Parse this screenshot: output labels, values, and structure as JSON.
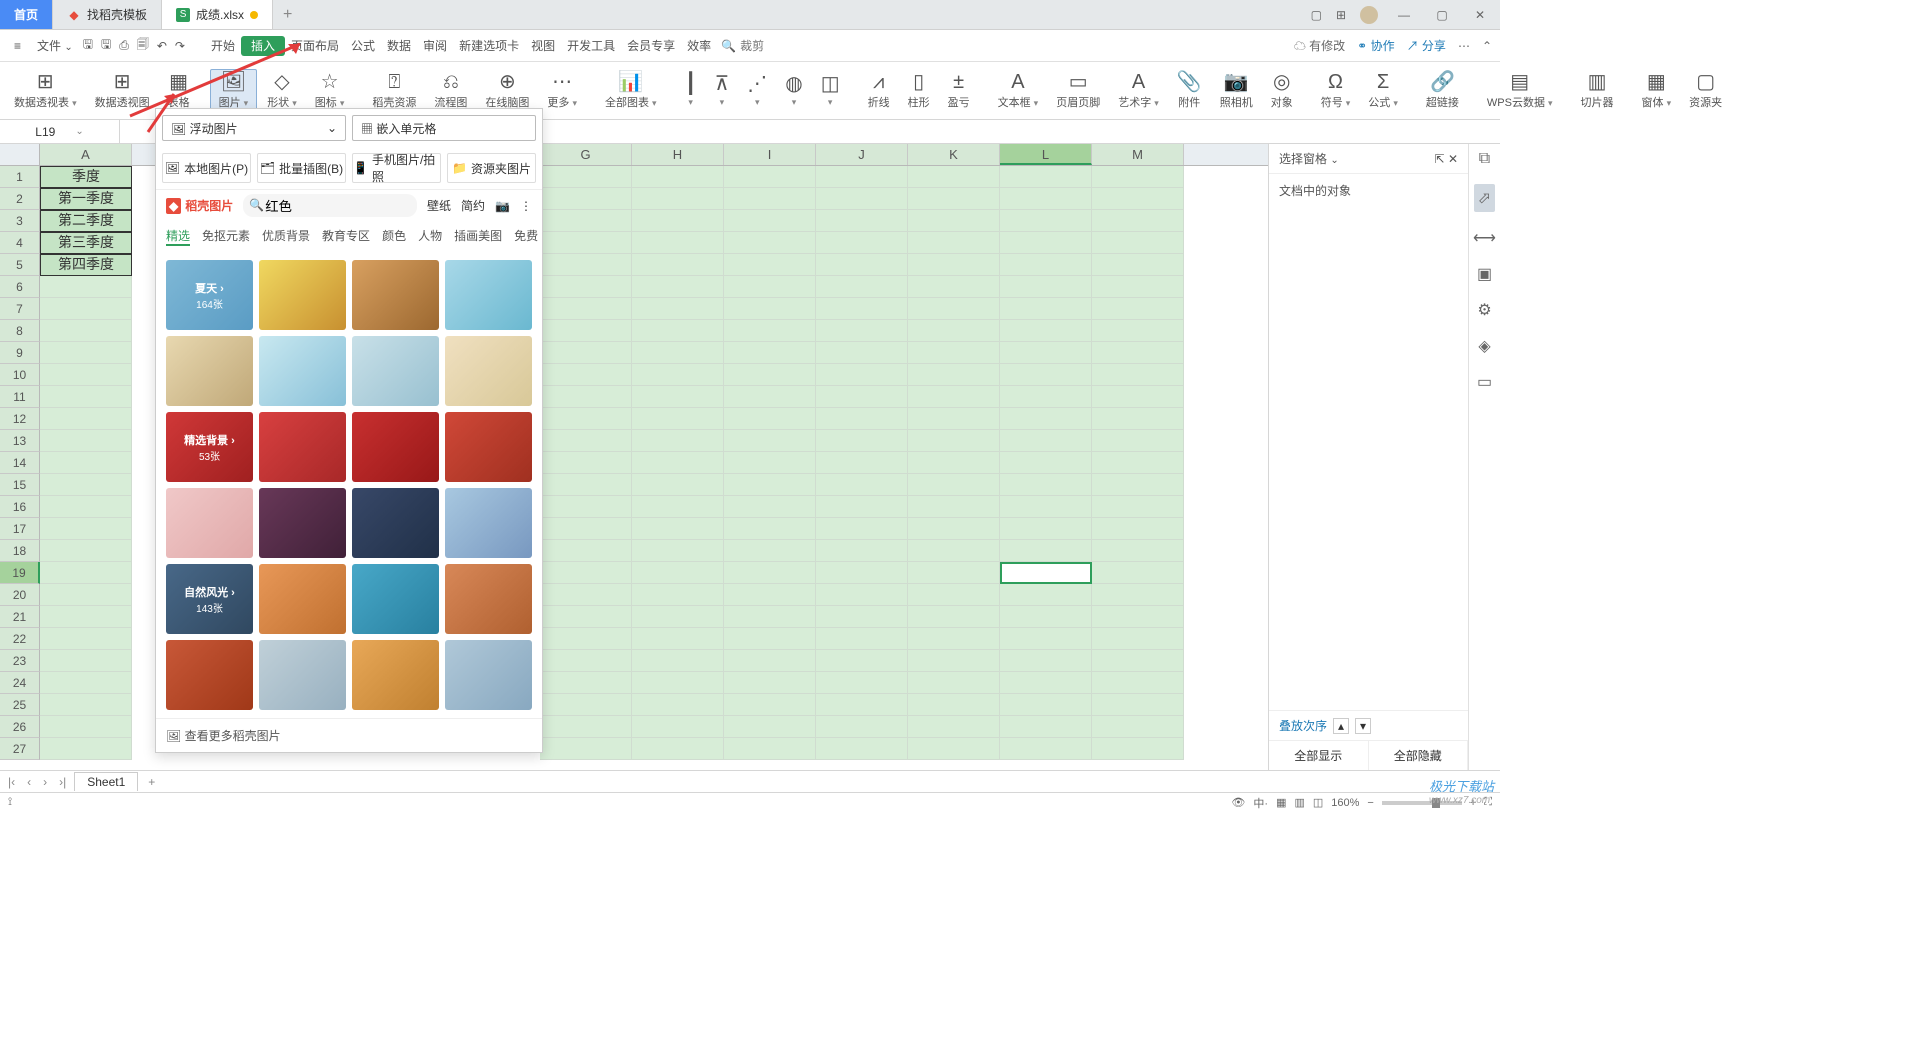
{
  "titlebar": {
    "home": "首页",
    "tab1": "找稻壳模板",
    "tab2": "成绩.xlsx",
    "add": "+"
  },
  "menu": {
    "file": "文件",
    "items": [
      "开始",
      "插入",
      "页面布局",
      "公式",
      "数据",
      "审阅",
      "新建选项卡",
      "视图",
      "开发工具",
      "会员专享",
      "效率"
    ],
    "search_placeholder": "裁剪",
    "right": {
      "change": "有修改",
      "collab": "协作",
      "share": "分享"
    }
  },
  "toolbar": [
    {
      "label": "数据透视表",
      "drop": true
    },
    {
      "label": "数据透视图"
    },
    {
      "label": "表格"
    },
    {
      "label": "图片",
      "drop": true,
      "hl": true
    },
    {
      "label": "形状",
      "drop": true
    },
    {
      "label": "图标",
      "drop": true
    },
    {
      "label": "稻壳资源"
    },
    {
      "label": "流程图"
    },
    {
      "label": "在线脑图"
    },
    {
      "label": "更多",
      "drop": true
    },
    {
      "label": "全部图表",
      "drop": true
    },
    {
      "label": "",
      "drop": true
    },
    {
      "label": "",
      "drop": true
    },
    {
      "label": "",
      "drop": true
    },
    {
      "label": "",
      "drop": true
    },
    {
      "label": "",
      "drop": true
    },
    {
      "label": "折线"
    },
    {
      "label": "柱形"
    },
    {
      "label": "盈亏"
    },
    {
      "label": "文本框",
      "drop": true
    },
    {
      "label": "页眉页脚"
    },
    {
      "label": "艺术字",
      "drop": true
    },
    {
      "label": "附件"
    },
    {
      "label": "照相机"
    },
    {
      "label": "对象"
    },
    {
      "label": "符号",
      "drop": true
    },
    {
      "label": "公式",
      "drop": true
    },
    {
      "label": "超链接"
    },
    {
      "label": "WPS云数据",
      "drop": true
    },
    {
      "label": "切片器"
    },
    {
      "label": "窗体",
      "drop": true
    },
    {
      "label": "资源夹"
    }
  ],
  "toolbar_icons": [
    "⊞",
    "⊞",
    "▦",
    "🖼",
    "◇",
    "☆",
    "⍰",
    "⎌",
    "⊕",
    "⋯",
    "📊",
    "┃",
    "⊼",
    "⋰",
    "◍",
    "◫",
    "⩘",
    "▯",
    "±",
    "A",
    "▭",
    "A",
    "📎",
    "📷",
    "◎",
    "Ω",
    "Σ",
    "🔗",
    "▤",
    "▥",
    "▦",
    "▢"
  ],
  "namebox": "L19",
  "columns": [
    "A",
    "G",
    "H",
    "I",
    "J",
    "K",
    "L",
    "M"
  ],
  "rowdata": {
    "1": "季度",
    "2": "第一季度",
    "3": "第二季度",
    "4": "第三季度",
    "5": "第四季度"
  },
  "imgpanel": {
    "combo": "浮动图片",
    "embed": "嵌入单元格",
    "btns": [
      "本地图片(P)",
      "批量插图(B)",
      "手机图片/拍照",
      "资源夹图片"
    ],
    "brand": "稻壳图片",
    "search": "红色",
    "links": [
      "壁纸",
      "简约"
    ],
    "cats": [
      "精选",
      "免抠元素",
      "优质背景",
      "教育专区",
      "颜色",
      "人物",
      "插画美图",
      "免费"
    ],
    "thumbs": [
      {
        "bg": "linear-gradient(135deg,#7fb8d6,#5a9cc4)",
        "title": "夏天 ›",
        "sub": "164张"
      },
      {
        "bg": "linear-gradient(135deg,#f0d860,#c89030)"
      },
      {
        "bg": "linear-gradient(135deg,#d8a060,#9c6830)"
      },
      {
        "bg": "linear-gradient(135deg,#a8d8e8,#6ab8d0)"
      },
      {
        "bg": "linear-gradient(135deg,#e8d8b0,#c0a878)"
      },
      {
        "bg": "linear-gradient(135deg,#c8e8f0,#88c0d8)"
      },
      {
        "bg": "linear-gradient(135deg,#c8e0e8,#98c0d0)"
      },
      {
        "bg": "linear-gradient(135deg,#f0e0c0,#d8c898)"
      },
      {
        "bg": "linear-gradient(135deg,#d03838,#a02020)",
        "title": "精选背景 ›",
        "sub": "53张"
      },
      {
        "bg": "linear-gradient(135deg,#d84040,#a82828)"
      },
      {
        "bg": "linear-gradient(135deg,#c83030,#981818)"
      },
      {
        "bg": "linear-gradient(135deg,#d04838,#a03020)"
      },
      {
        "bg": "linear-gradient(135deg,#f0c8c8,#e0a8a8)"
      },
      {
        "bg": "linear-gradient(135deg,#683858,#402038)"
      },
      {
        "bg": "linear-gradient(135deg,#384868,#203048)"
      },
      {
        "bg": "linear-gradient(135deg,#a8c8e0,#7898c0)"
      },
      {
        "bg": "linear-gradient(135deg,#486888,#304860)",
        "title": "自然风光 ›",
        "sub": "143张"
      },
      {
        "bg": "linear-gradient(135deg,#e89858,#c07030)"
      },
      {
        "bg": "linear-gradient(135deg,#48a8c8,#2880a0)"
      },
      {
        "bg": "linear-gradient(135deg,#d88858,#b06030)"
      },
      {
        "bg": "linear-gradient(135deg,#c85838,#a03818)"
      },
      {
        "bg": "linear-gradient(135deg,#c0d0d8,#98b0c0)"
      },
      {
        "bg": "linear-gradient(135deg,#e8a858,#c08030)"
      },
      {
        "bg": "linear-gradient(135deg,#b0c8d8,#88a8c0)"
      }
    ],
    "more": "查看更多稻壳图片"
  },
  "rightpanel": {
    "title": "选择窗格",
    "body": "文档中的对象",
    "order": "叠放次序",
    "show": "全部显示",
    "hide": "全部隐藏"
  },
  "sheettab": "Sheet1",
  "status": {
    "zoom": "160%"
  },
  "watermark": {
    "t": "极光下载站",
    "u": "www.xz7.com"
  }
}
